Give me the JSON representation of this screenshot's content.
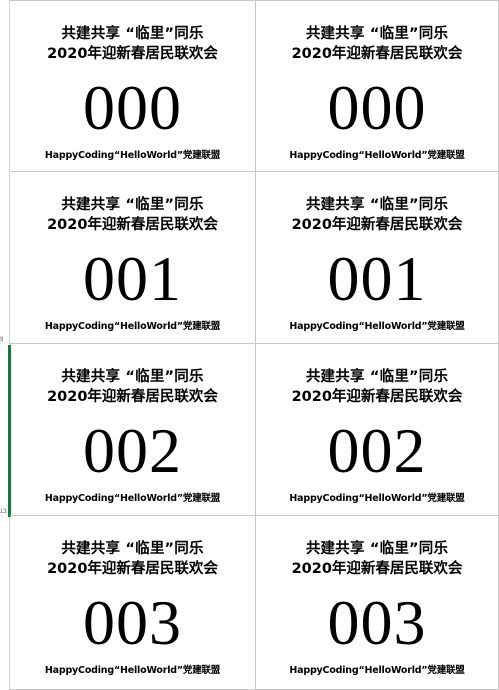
{
  "sheet": {
    "row_headers": [
      "9",
      "13"
    ],
    "tickets": [
      {
        "line1": "共建共享 “临里”同乐",
        "line2": "2020年迎新春居民联欢会",
        "number": "000",
        "footer": "HappyCoding“HelloWorld”党建联盟"
      },
      {
        "line1": "共建共享 “临里”同乐",
        "line2": "2020年迎新春居民联欢会",
        "number": "000",
        "footer": "HappyCoding“HelloWorld”党建联盟"
      },
      {
        "line1": "共建共享 “临里”同乐",
        "line2": "2020年迎新春居民联欢会",
        "number": "001",
        "footer": "HappyCoding“HelloWorld”党建联盟"
      },
      {
        "line1": "共建共享 “临里”同乐",
        "line2": "2020年迎新春居民联欢会",
        "number": "001",
        "footer": "HappyCoding“HelloWorld”党建联盟"
      },
      {
        "line1": "共建共享 “临里”同乐",
        "line2": "2020年迎新春居民联欢会",
        "number": "002",
        "footer": "HappyCoding“HelloWorld”党建联盟"
      },
      {
        "line1": "共建共享 “临里”同乐",
        "line2": "2020年迎新春居民联欢会",
        "number": "002",
        "footer": "HappyCoding“HelloWorld”党建联盟"
      },
      {
        "line1": "共建共享 “临里”同乐",
        "line2": "2020年迎新春居民联欢会",
        "number": "003",
        "footer": "HappyCoding“HelloWorld”党建联盟"
      },
      {
        "line1": "共建共享 “临里”同乐",
        "line2": "2020年迎新春居民联欢会",
        "number": "003",
        "footer": "HappyCoding“HelloWorld”党建联盟"
      }
    ]
  },
  "colors": {
    "gridline": "#c8c8c8",
    "selection_accent": "#217346",
    "text": "#000000",
    "background": "#ffffff"
  }
}
